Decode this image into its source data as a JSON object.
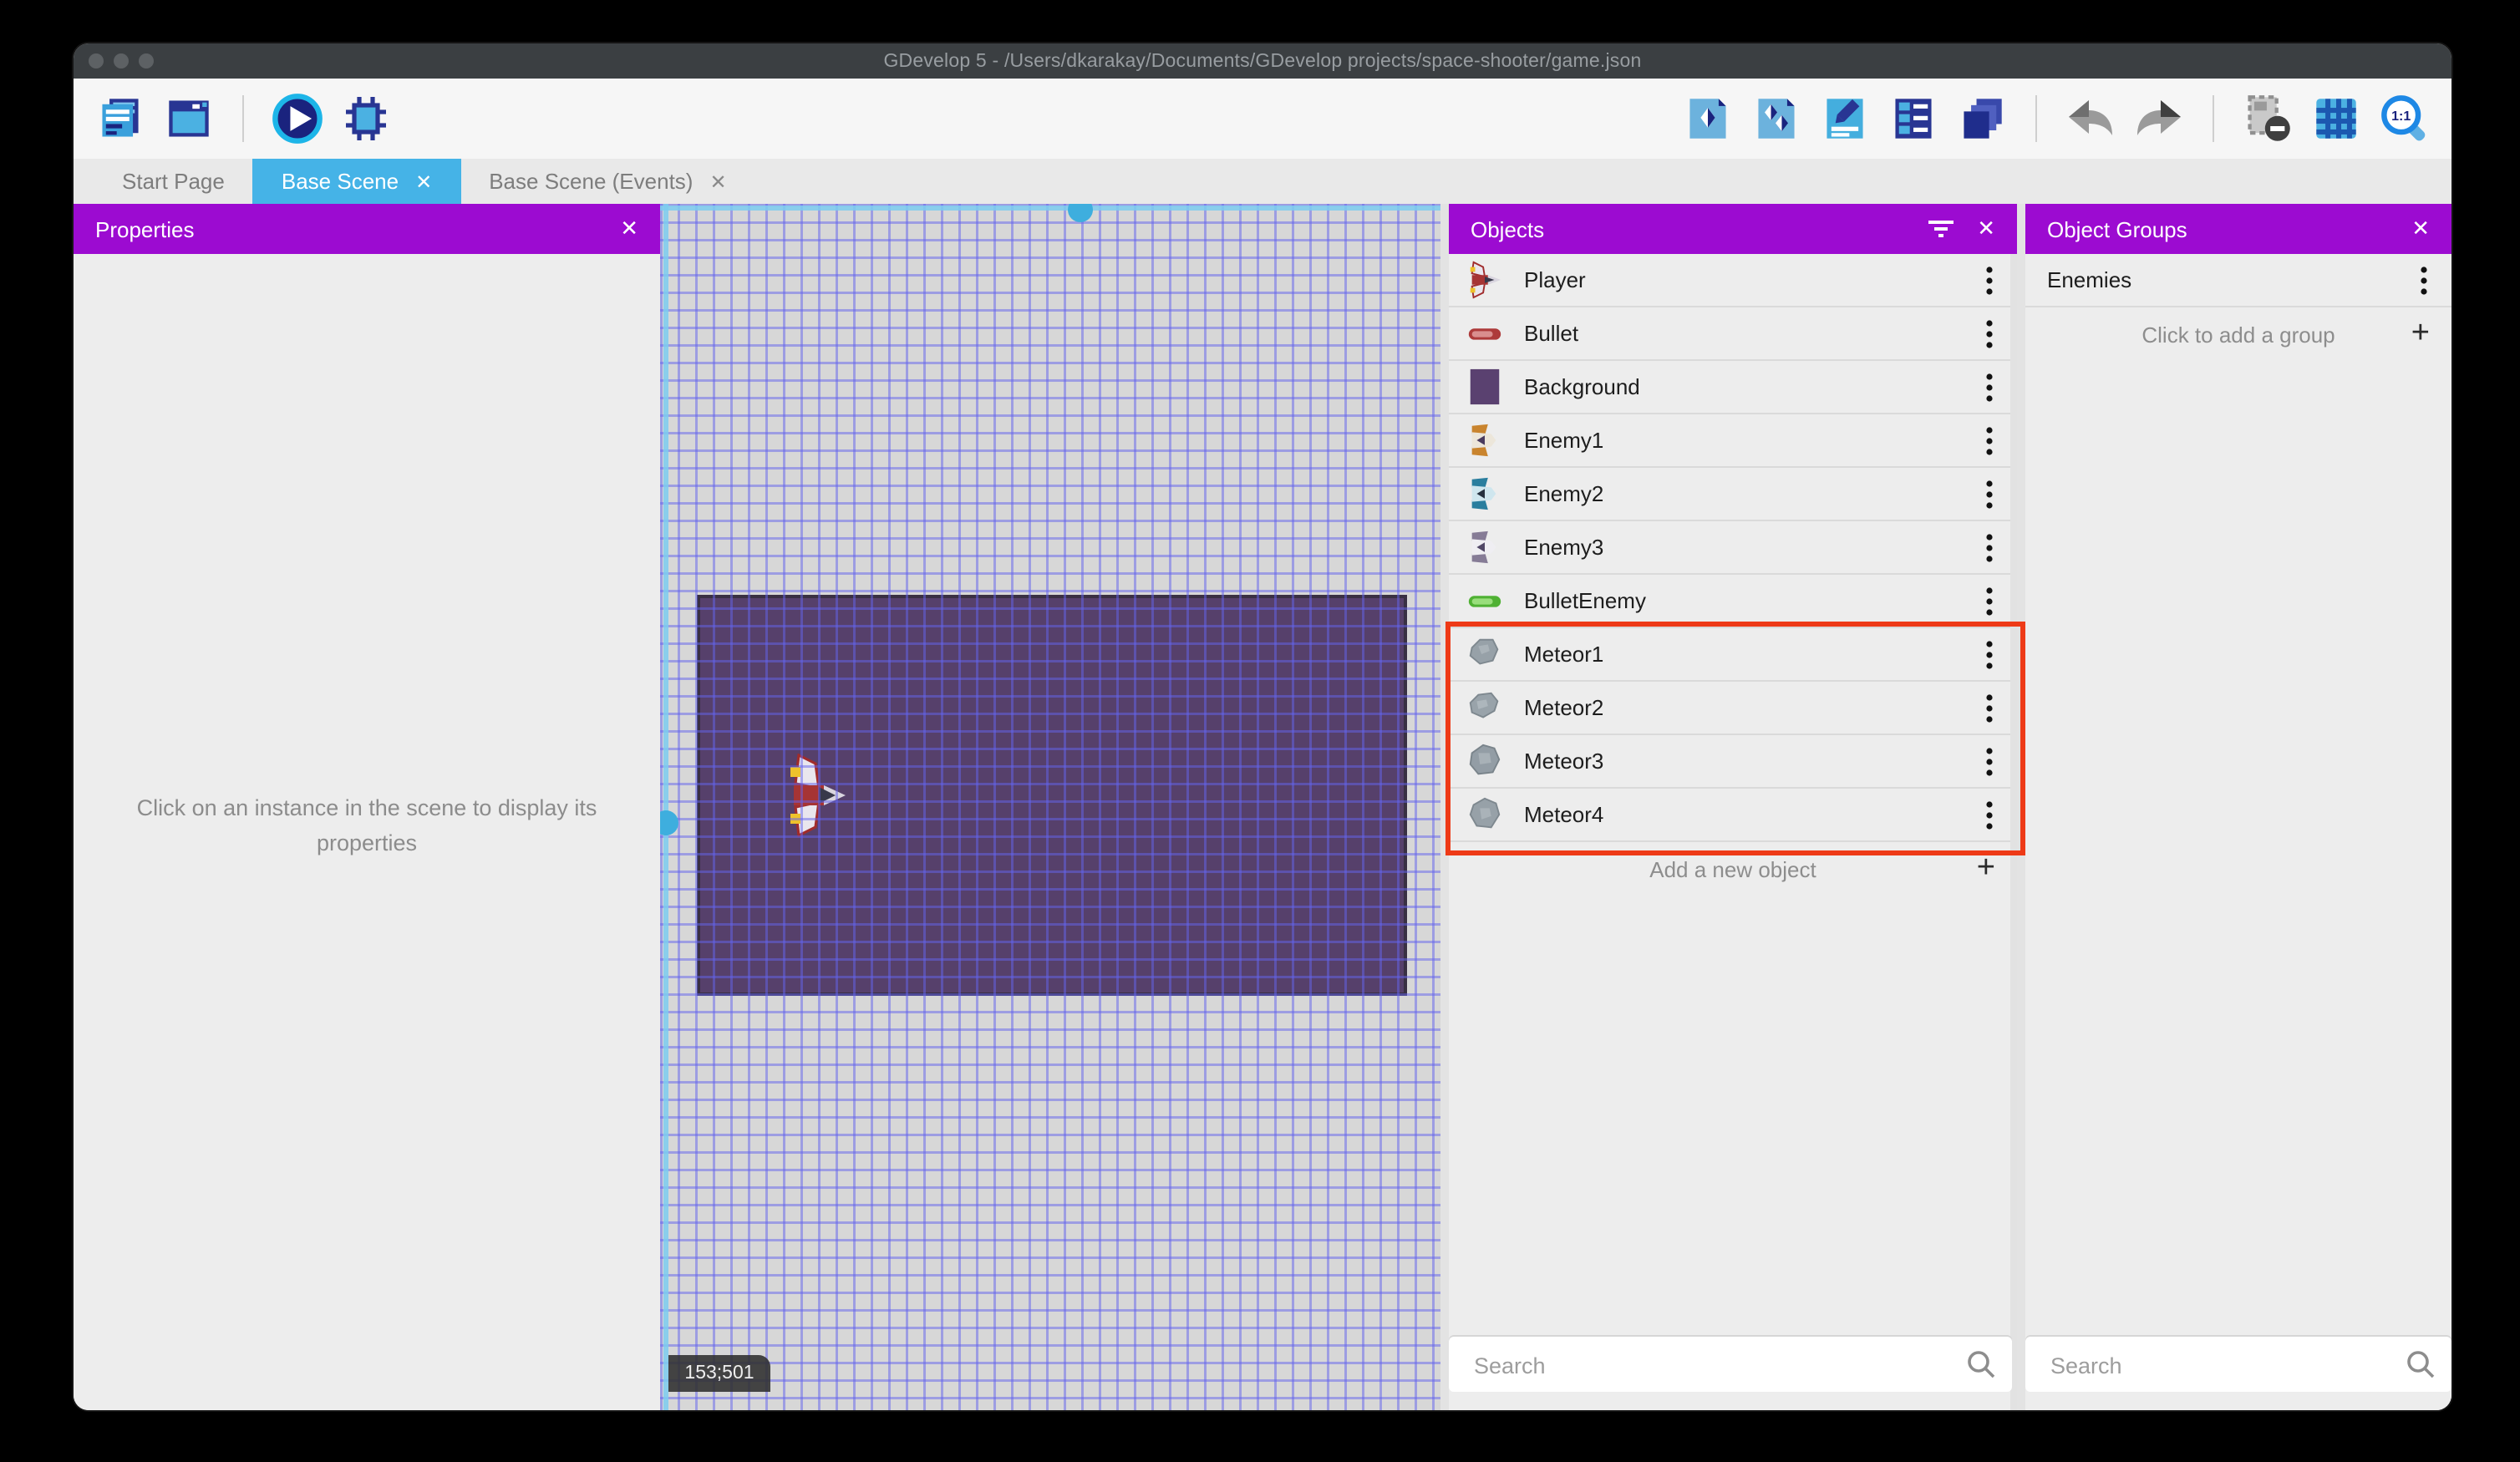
{
  "window": {
    "title": "GDevelop 5 - /Users/dkarakay/Documents/GDevelop projects/space-shooter/game.json"
  },
  "toolbar": {
    "left_icons": [
      "project-manager",
      "scene-editor",
      "preview-play",
      "debug"
    ],
    "right_icons": [
      "objects-panel-toggle",
      "object-groups-toggle",
      "instance-properties",
      "instances-list",
      "layers",
      "undo",
      "redo",
      "mask-preview",
      "grid-toggle",
      "zoom-original"
    ]
  },
  "tabs": [
    {
      "label": "Start Page",
      "active": false,
      "closable": false
    },
    {
      "label": "Base Scene",
      "active": true,
      "closable": true,
      "close_glyph": "✕"
    },
    {
      "label": "Base Scene (Events)",
      "active": false,
      "closable": true,
      "close_glyph": "✕"
    }
  ],
  "properties_panel": {
    "title": "Properties",
    "close_glyph": "✕",
    "empty_message": "Click on an instance in the scene to display its properties"
  },
  "scene": {
    "cursor_coordinates": "153;501"
  },
  "objects_panel": {
    "title": "Objects",
    "close_glyph": "✕",
    "items": [
      {
        "label": "Player",
        "icon": "player-ship"
      },
      {
        "label": "Bullet",
        "icon": "red-bullet"
      },
      {
        "label": "Background",
        "icon": "purple-square"
      },
      {
        "label": "Enemy1",
        "icon": "orange-ship"
      },
      {
        "label": "Enemy2",
        "icon": "teal-ship"
      },
      {
        "label": "Enemy3",
        "icon": "gray-ship"
      },
      {
        "label": "BulletEnemy",
        "icon": "green-bullet"
      },
      {
        "label": "Meteor1",
        "icon": "meteor"
      },
      {
        "label": "Meteor2",
        "icon": "meteor"
      },
      {
        "label": "Meteor3",
        "icon": "meteor"
      },
      {
        "label": "Meteor4",
        "icon": "meteor"
      }
    ],
    "add_button_label": "Add a new object",
    "search_placeholder": "Search",
    "highlighted_items": [
      "Meteor1",
      "Meteor2",
      "Meteor3",
      "Meteor4"
    ]
  },
  "object_groups_panel": {
    "title": "Object Groups",
    "close_glyph": "✕",
    "groups": [
      {
        "label": "Enemies"
      }
    ],
    "add_button_label": "Click to add a group",
    "search_placeholder": "Search"
  },
  "colors": {
    "panel_header_purple": "#9c0bd1",
    "active_tab_blue": "#45b3e7",
    "annotation_red": "#ee3a17",
    "scene_background_purple": "#56406b",
    "titlebar_dark": "#3b3f42"
  }
}
